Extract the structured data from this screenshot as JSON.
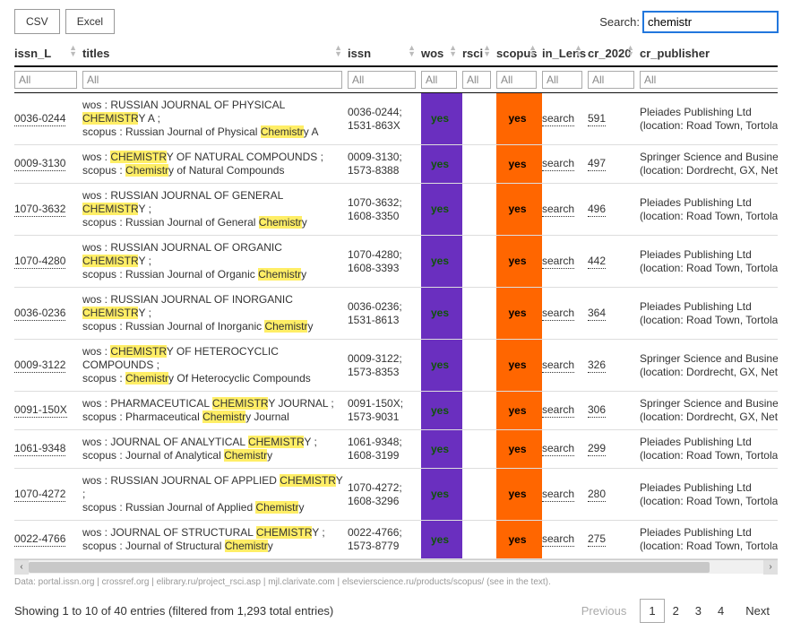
{
  "export": {
    "csv": "CSV",
    "excel": "Excel"
  },
  "search": {
    "label": "Search:",
    "value": "chemistr"
  },
  "columns": [
    {
      "key": "issn_L",
      "label": "issn_L"
    },
    {
      "key": "titles",
      "label": "titles"
    },
    {
      "key": "issn",
      "label": "issn"
    },
    {
      "key": "wos",
      "label": "wos"
    },
    {
      "key": "rsci",
      "label": "rsci"
    },
    {
      "key": "scopus",
      "label": "scopus"
    },
    {
      "key": "in_Lens",
      "label": "in_Lens"
    },
    {
      "key": "cr_2020",
      "label": "cr_2020"
    },
    {
      "key": "cr_publisher",
      "label": "cr_publisher"
    }
  ],
  "filter_placeholder": "All",
  "rows": [
    {
      "issn_L": "0036-0244",
      "title_l1_pre": "wos : RUSSIAN JOURNAL OF PHYSICAL ",
      "title_l1_hl": "CHEMISTR",
      "title_l1_post": "Y A ;",
      "title_l2_pre": "scopus : Russian Journal of Physical ",
      "title_l2_hl": "Chemistr",
      "title_l2_post": "y A",
      "issn_l1": "0036-0244;",
      "issn_l2": "1531-863X",
      "wos": "yes",
      "scopus": "yes",
      "in_lens": "search",
      "cr_2020": "591",
      "pub_l1": "Pleiades Publishing Ltd",
      "pub_l2": "(location: Road Town, Tortola"
    },
    {
      "issn_L": "0009-3130",
      "title_l1_pre": "wos : ",
      "title_l1_hl": "CHEMISTR",
      "title_l1_post": "Y OF NATURAL COMPOUNDS ;",
      "title_l2_pre": "scopus : ",
      "title_l2_hl": "Chemistr",
      "title_l2_post": "y of Natural Compounds",
      "issn_l1": "0009-3130;",
      "issn_l2": "1573-8388",
      "wos": "yes",
      "scopus": "yes",
      "in_lens": "search",
      "cr_2020": "497",
      "pub_l1": "Springer Science and Busine",
      "pub_l2": "(location: Dordrecht, GX, Net"
    },
    {
      "issn_L": "1070-3632",
      "title_l1_pre": "wos : RUSSIAN JOURNAL OF GENERAL ",
      "title_l1_hl": "CHEMISTR",
      "title_l1_post": "Y ;",
      "title_l2_pre": "scopus : Russian Journal of General ",
      "title_l2_hl": "Chemistr",
      "title_l2_post": "y",
      "issn_l1": "1070-3632;",
      "issn_l2": "1608-3350",
      "wos": "yes",
      "scopus": "yes",
      "in_lens": "search",
      "cr_2020": "496",
      "pub_l1": "Pleiades Publishing Ltd",
      "pub_l2": "(location: Road Town, Tortola"
    },
    {
      "issn_L": "1070-4280",
      "title_l1_pre": "wos : RUSSIAN JOURNAL OF ORGANIC ",
      "title_l1_hl": "CHEMISTR",
      "title_l1_post": "Y ;",
      "title_l2_pre": "scopus : Russian Journal of Organic ",
      "title_l2_hl": "Chemistr",
      "title_l2_post": "y",
      "issn_l1": "1070-4280;",
      "issn_l2": "1608-3393",
      "wos": "yes",
      "scopus": "yes",
      "in_lens": "search",
      "cr_2020": "442",
      "pub_l1": "Pleiades Publishing Ltd",
      "pub_l2": "(location: Road Town, Tortola"
    },
    {
      "issn_L": "0036-0236",
      "title_l1_pre": "wos : RUSSIAN JOURNAL OF INORGANIC ",
      "title_l1_hl": "CHEMISTR",
      "title_l1_post": "Y ;",
      "title_l2_pre": "scopus : Russian Journal of Inorganic ",
      "title_l2_hl": "Chemistr",
      "title_l2_post": "y",
      "issn_l1": "0036-0236;",
      "issn_l2": "1531-8613",
      "wos": "yes",
      "scopus": "yes",
      "in_lens": "search",
      "cr_2020": "364",
      "pub_l1": "Pleiades Publishing Ltd",
      "pub_l2": "(location: Road Town, Tortola"
    },
    {
      "issn_L": "0009-3122",
      "title_l1_pre": "wos : ",
      "title_l1_hl": "CHEMISTR",
      "title_l1_post": "Y OF HETEROCYCLIC COMPOUNDS ;",
      "title_l2_pre": "scopus : ",
      "title_l2_hl": "Chemistr",
      "title_l2_post": "y Of Heterocyclic Compounds",
      "issn_l1": "0009-3122;",
      "issn_l2": "1573-8353",
      "wos": "yes",
      "scopus": "yes",
      "in_lens": "search",
      "cr_2020": "326",
      "pub_l1": "Springer Science and Busine",
      "pub_l2": "(location: Dordrecht, GX, Net"
    },
    {
      "issn_L": "0091-150X",
      "title_l1_pre": "wos : PHARMACEUTICAL ",
      "title_l1_hl": "CHEMISTR",
      "title_l1_post": "Y JOURNAL ;",
      "title_l2_pre": "scopus : Pharmaceutical ",
      "title_l2_hl": "Chemistr",
      "title_l2_post": "y Journal",
      "issn_l1": "0091-150X;",
      "issn_l2": "1573-9031",
      "wos": "yes",
      "scopus": "yes",
      "in_lens": "search",
      "cr_2020": "306",
      "pub_l1": "Springer Science and Busine",
      "pub_l2": "(location: Dordrecht, GX, Net"
    },
    {
      "issn_L": "1061-9348",
      "title_l1_pre": "wos : JOURNAL OF ANALYTICAL ",
      "title_l1_hl": "CHEMISTR",
      "title_l1_post": "Y ;",
      "title_l2_pre": "scopus : Journal of Analytical ",
      "title_l2_hl": "Chemistr",
      "title_l2_post": "y",
      "issn_l1": "1061-9348;",
      "issn_l2": "1608-3199",
      "wos": "yes",
      "scopus": "yes",
      "in_lens": "search",
      "cr_2020": "299",
      "pub_l1": "Pleiades Publishing Ltd",
      "pub_l2": "(location: Road Town, Tortola"
    },
    {
      "issn_L": "1070-4272",
      "title_l1_pre": "wos : RUSSIAN JOURNAL OF APPLIED ",
      "title_l1_hl": "CHEMISTR",
      "title_l1_post": "Y ;",
      "title_l2_pre": "scopus : Russian Journal of Applied ",
      "title_l2_hl": "Chemistr",
      "title_l2_post": "y",
      "issn_l1": "1070-4272;",
      "issn_l2": "1608-3296",
      "wos": "yes",
      "scopus": "yes",
      "in_lens": "search",
      "cr_2020": "280",
      "pub_l1": "Pleiades Publishing Ltd",
      "pub_l2": "(location: Road Town, Tortola"
    },
    {
      "issn_L": "0022-4766",
      "title_l1_pre": "wos : JOURNAL OF STRUCTURAL ",
      "title_l1_hl": "CHEMISTR",
      "title_l1_post": "Y ;",
      "title_l2_pre": "scopus : Journal of Structural ",
      "title_l2_hl": "Chemistr",
      "title_l2_post": "y",
      "issn_l1": "0022-4766;",
      "issn_l2": "1573-8779",
      "wos": "yes",
      "scopus": "yes",
      "in_lens": "search",
      "cr_2020": "275",
      "pub_l1": "Pleiades Publishing Ltd",
      "pub_l2": "(location: Road Town, Tortola"
    }
  ],
  "data_note": "Data: portal.issn.org | crossref.org | elibrary.ru/project_rsci.asp | mjl.clarivate.com | elsevierscience.ru/products/scopus/ (see in the text).",
  "info": "Showing 1 to 10 of 40 entries (filtered from 1,293 total entries)",
  "pager": {
    "prev": "Previous",
    "next": "Next",
    "pages": [
      "1",
      "2",
      "3",
      "4"
    ],
    "active": 0
  }
}
